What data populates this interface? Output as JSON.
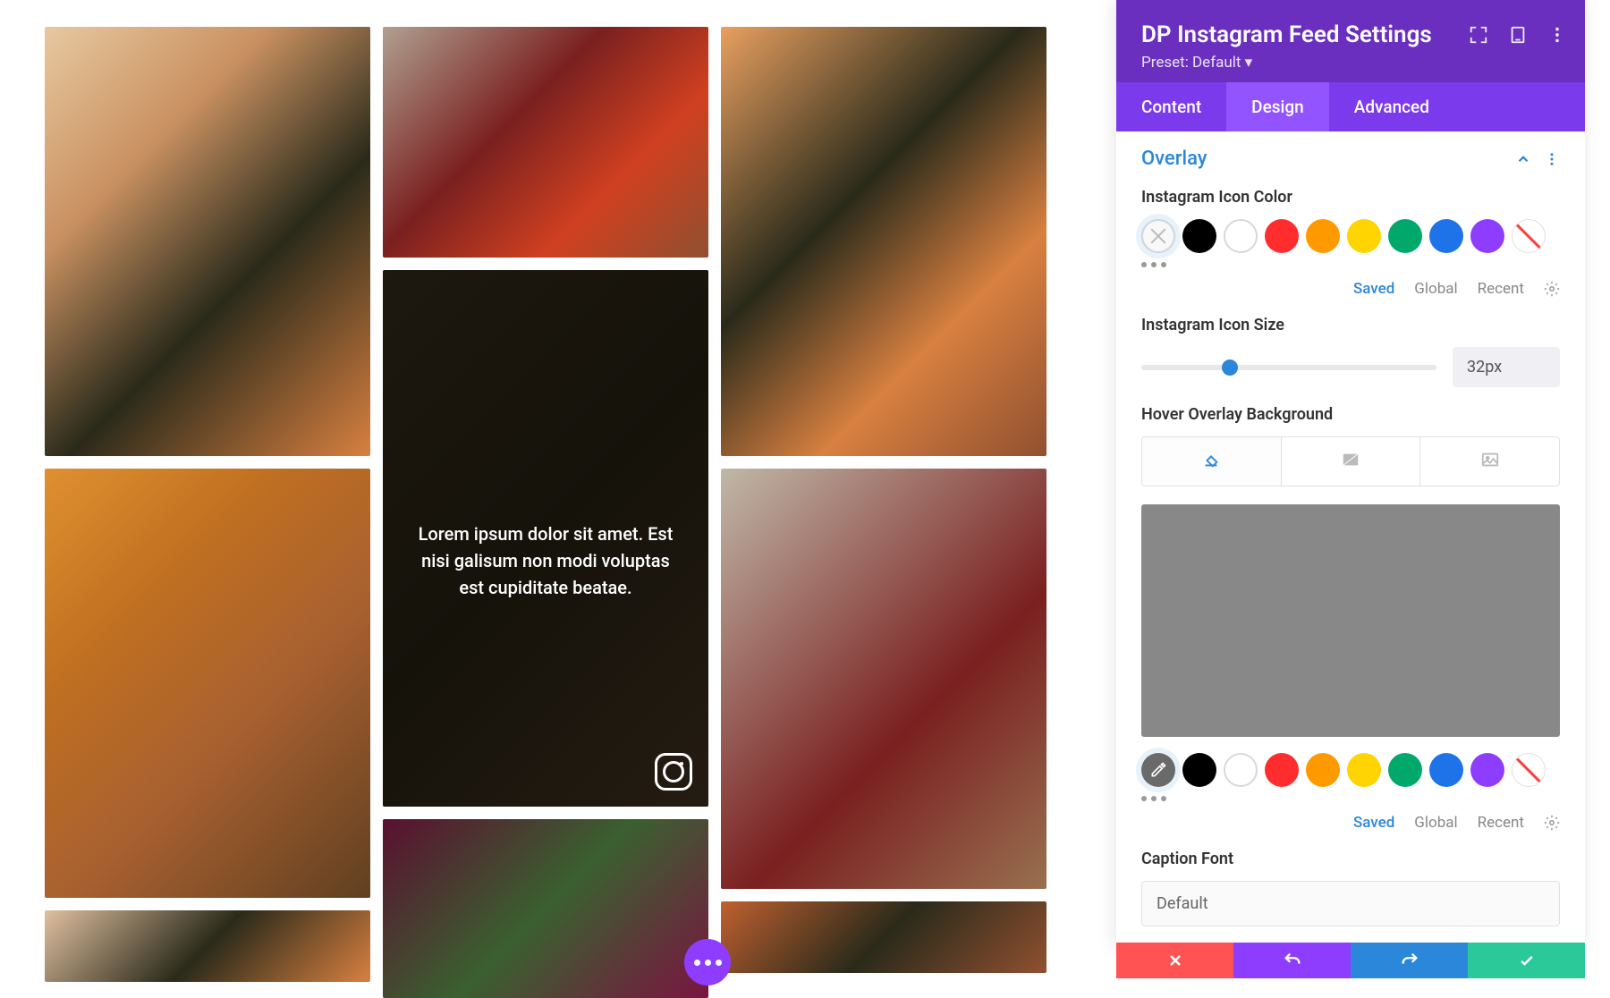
{
  "panel": {
    "title": "DP Instagram Feed Settings",
    "preset_label": "Preset: Default ▾"
  },
  "tabs": {
    "content": "Content",
    "design": "Design",
    "advanced": "Advanced"
  },
  "section": {
    "overlay_title": "Overlay"
  },
  "fields": {
    "icon_color_label": "Instagram Icon Color",
    "icon_size_label": "Instagram Icon Size",
    "icon_size_value": "32px",
    "hover_bg_label": "Hover Overlay Background",
    "caption_font_label": "Caption Font",
    "caption_font_value": "Default"
  },
  "swatch_footer": {
    "saved": "Saved",
    "global": "Global",
    "recent": "Recent"
  },
  "palette": {
    "black": "#000000",
    "white_ring": "#ffffff",
    "red": "#ff2d2d",
    "orange": "#ff9900",
    "yellow": "#ffd400",
    "teal": "#00a86b",
    "blue": "#1e73e8",
    "purple": "#8e3dff"
  },
  "feed": {
    "overlay_caption": "Lorem ipsum dolor sit amet. Est nisi galisum non modi voluptas est cupiditate beatae."
  },
  "bg_preview_color": "#888888"
}
